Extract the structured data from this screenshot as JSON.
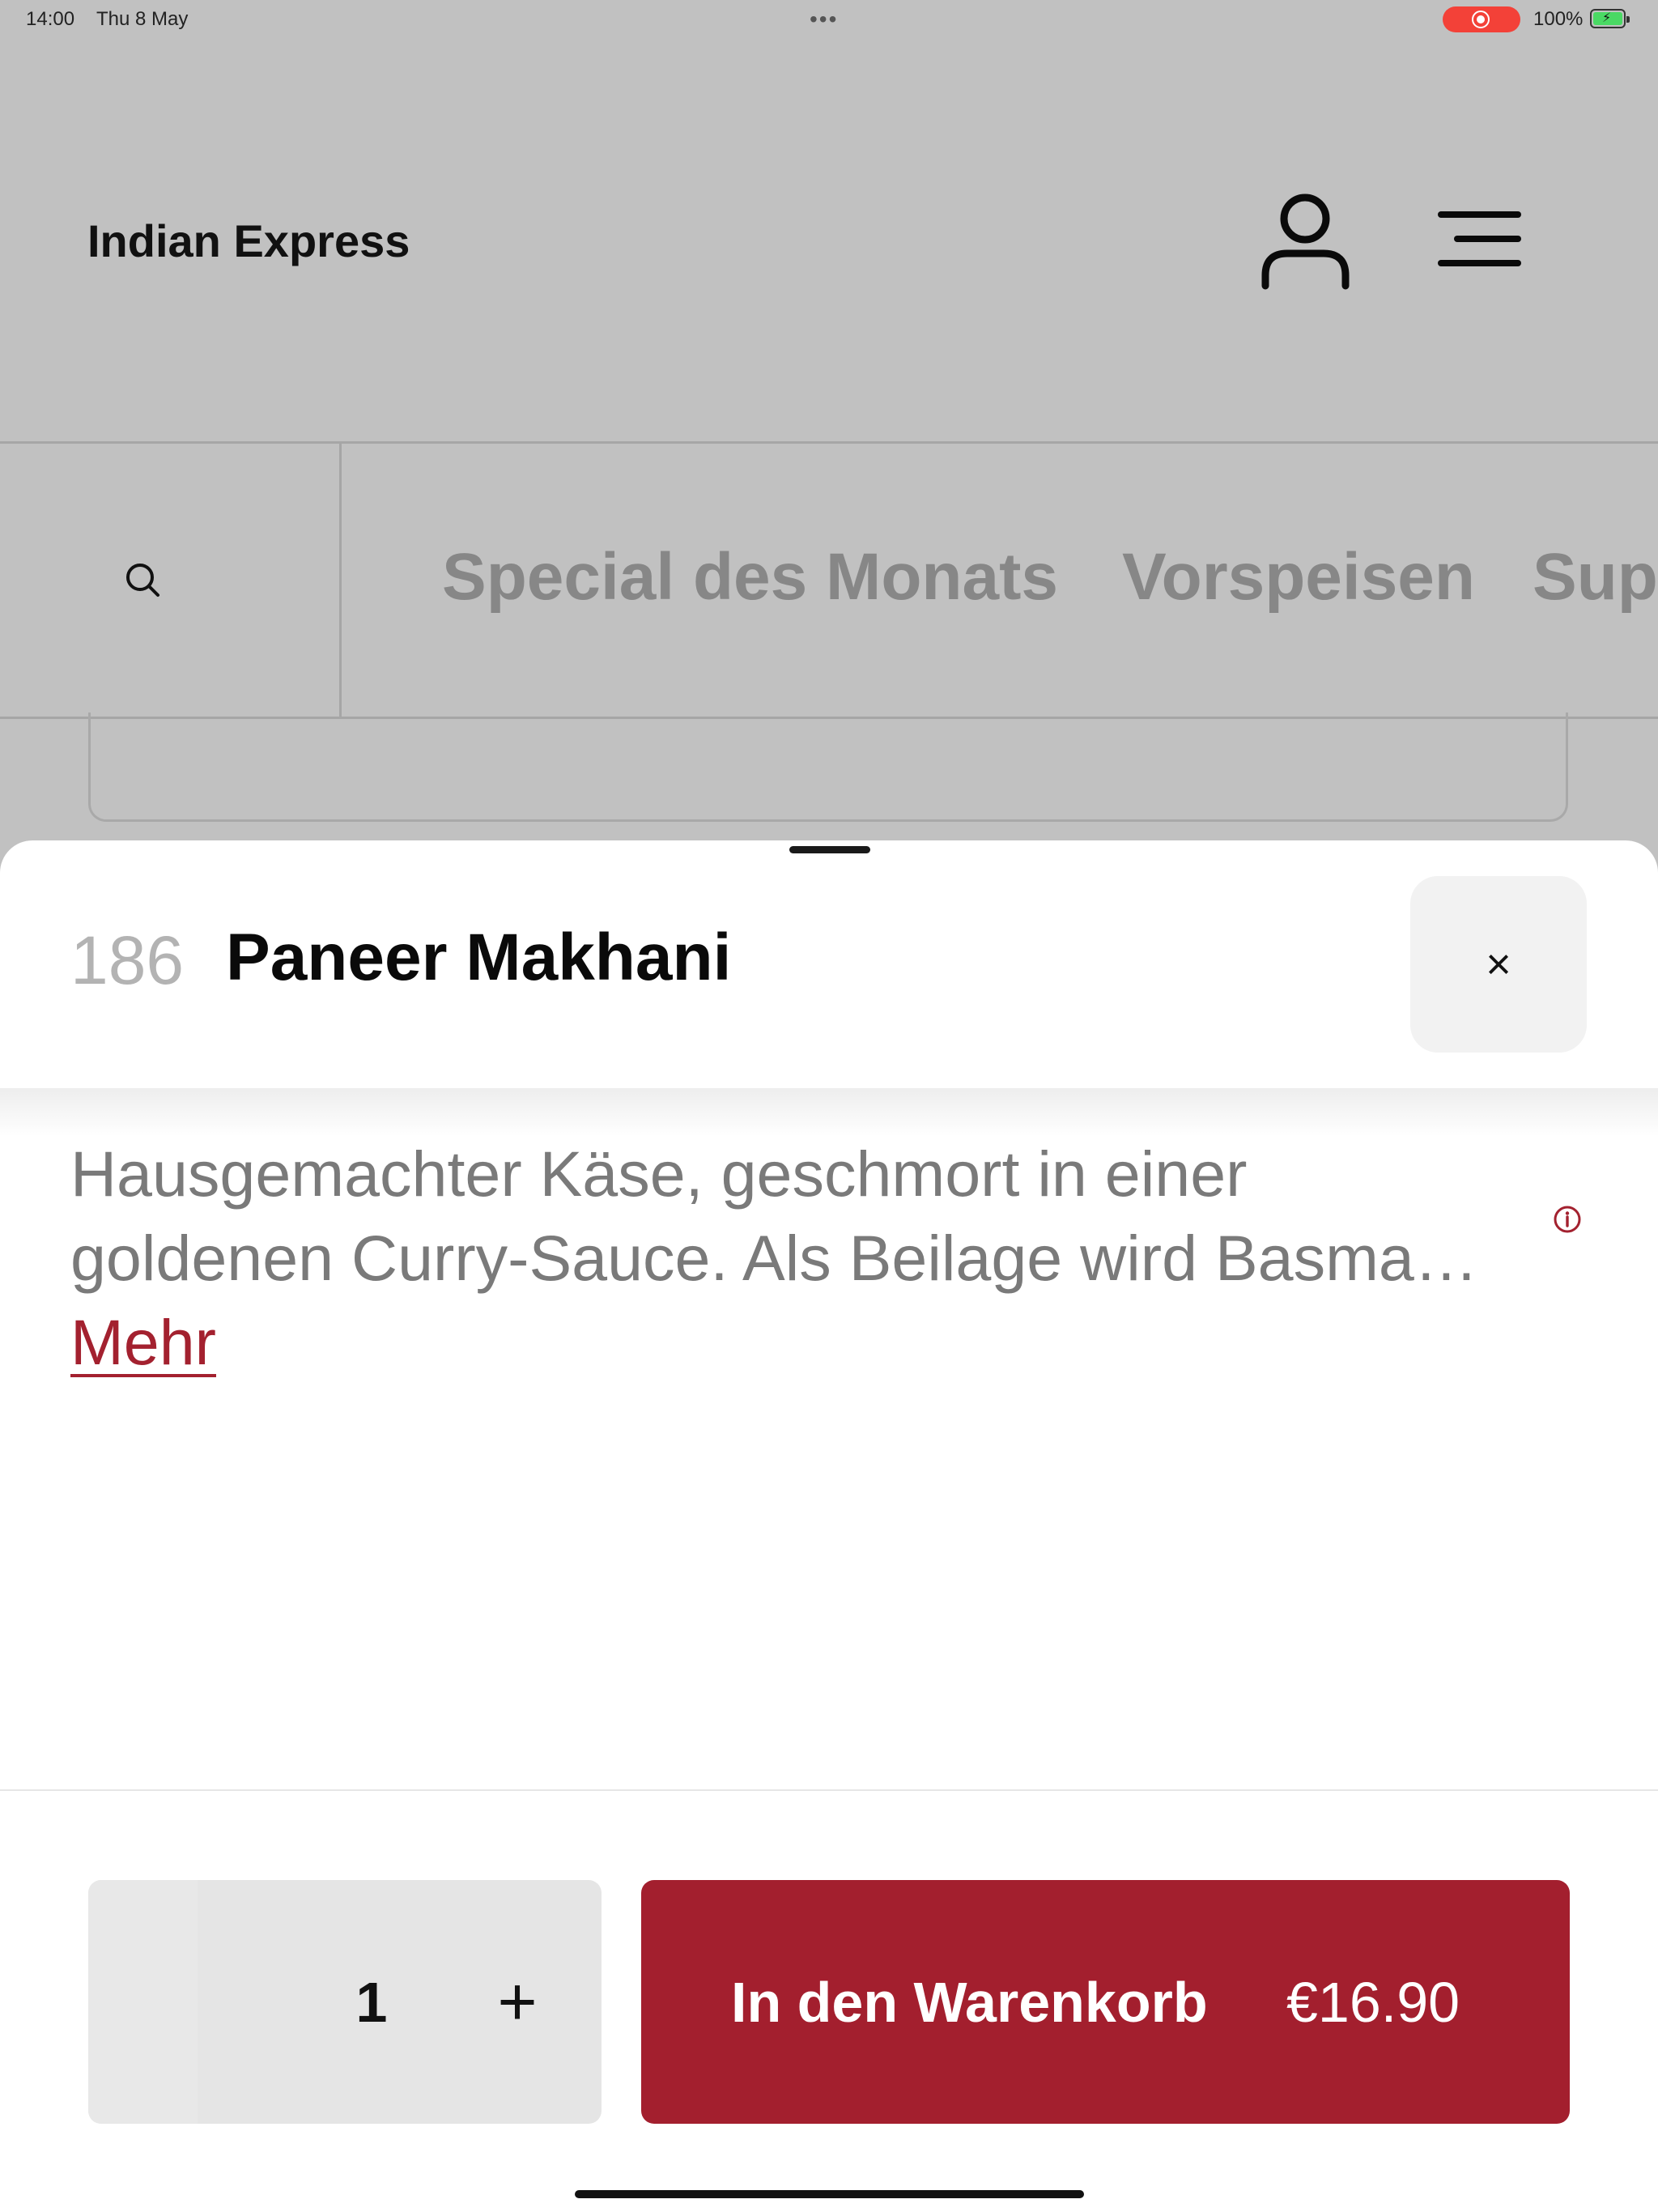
{
  "status_bar": {
    "time": "14:00",
    "date": "Thu 8 May",
    "battery": "100%",
    "battery_level": 1.0,
    "recording": true
  },
  "header": {
    "title": "Indian Express",
    "user_icon": "user-icon",
    "menu_icon": "hamburger-menu-icon"
  },
  "categories": {
    "search_icon": "search-icon",
    "items": [
      "Special des Monats",
      "Vorspeisen",
      "Sup"
    ]
  },
  "sheet": {
    "item_number": "186",
    "item_name": "Paneer Makhani",
    "close_label": "×",
    "description_line1": "Hausgemachter Käse, geschmort in einer",
    "description_line2": "goldenen Curry-Sauce. Als Beilage wird Basma…",
    "more_link": "Mehr",
    "info_icon": "info-icon"
  },
  "order": {
    "quantity": "1",
    "plus_label": "+",
    "add_to_cart_label": "In den Warenkorb",
    "price": "€16.90"
  },
  "colors": {
    "accent": "#a31f2e",
    "dim_background": "#c1c1c1",
    "record_pill": "#f34138"
  }
}
